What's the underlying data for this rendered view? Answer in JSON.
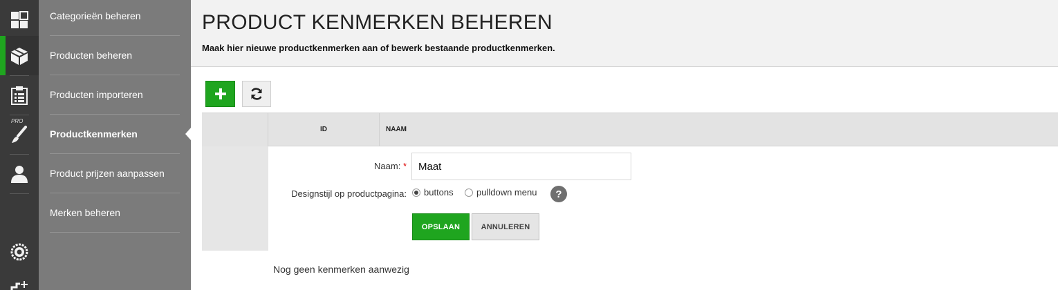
{
  "rail": {
    "pro_label": "PRO"
  },
  "submenu": {
    "items": [
      {
        "label": "Categorieën beheren"
      },
      {
        "label": "Producten beheren"
      },
      {
        "label": "Producten importeren"
      },
      {
        "label": "Productkenmerken"
      },
      {
        "label": "Product prijzen aanpassen"
      },
      {
        "label": "Merken beheren"
      }
    ]
  },
  "header": {
    "title": "PRODUCT KENMERKEN BEHEREN",
    "subtitle": "Maak hier nieuwe productkenmerken aan of bewerk bestaande productkenmerken."
  },
  "table": {
    "columns": [
      "ID",
      "NAAM"
    ]
  },
  "form": {
    "naam_label": "Naam:",
    "required_mark": "*",
    "naam_value": "Maat",
    "design_label": "Designstijl op productpagina:",
    "radio_options": [
      {
        "label": "buttons",
        "checked": true
      },
      {
        "label": "pulldown menu",
        "checked": false
      }
    ],
    "help_symbol": "?",
    "save_label": "OPSLAAN",
    "cancel_label": "ANNULEREN"
  },
  "empty_message": "Nog geen kenmerken aanwezig",
  "colors": {
    "accent_green": "#1fa51f",
    "rail_bg": "#3a3a3a",
    "submenu_bg": "#7b7b7b"
  }
}
